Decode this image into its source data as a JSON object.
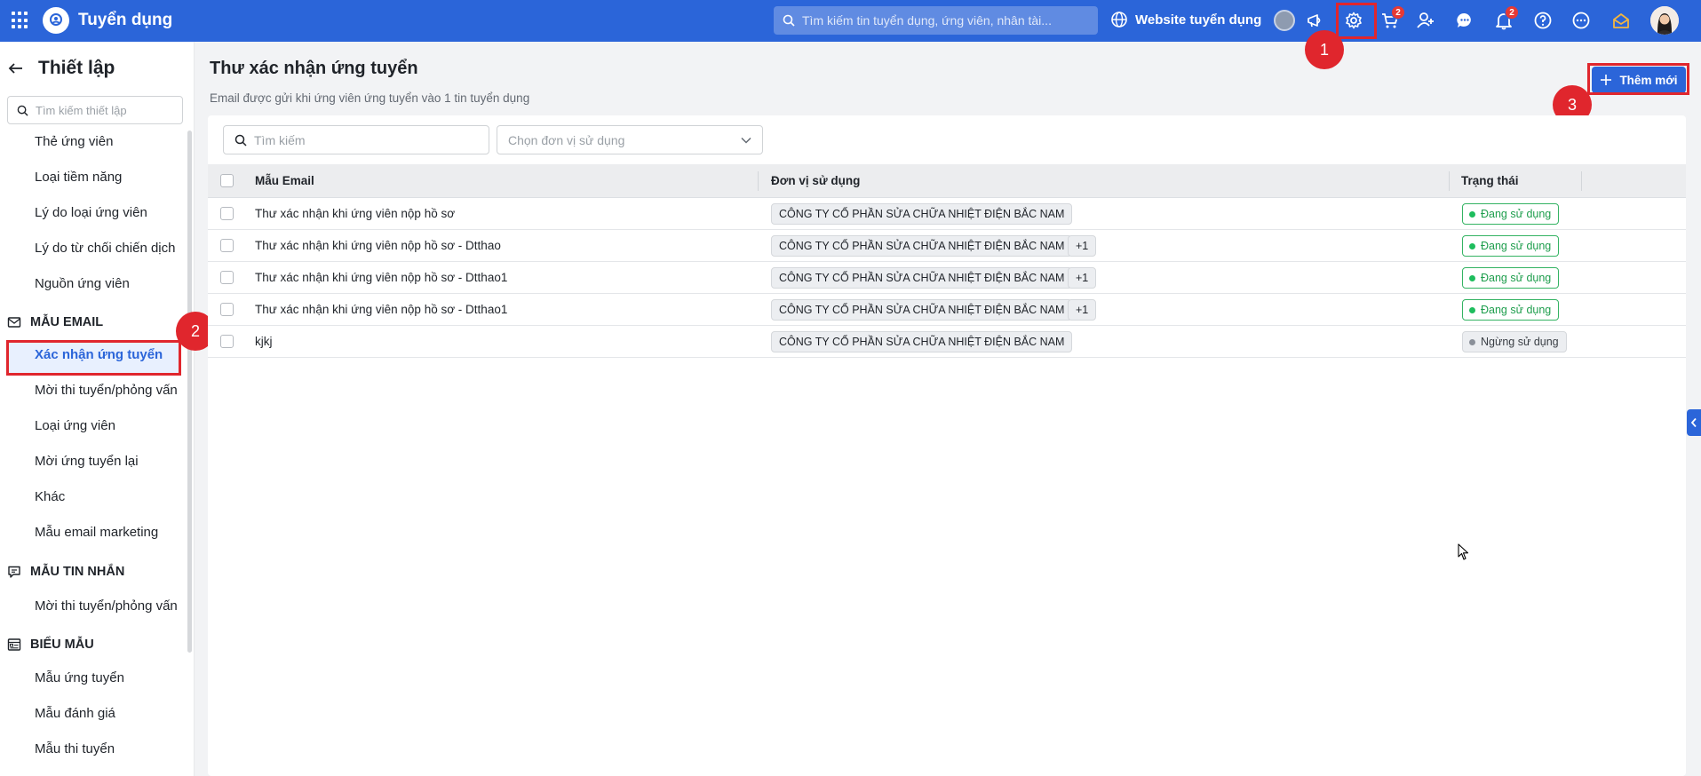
{
  "app": {
    "name": "Tuyển dụng"
  },
  "topbar": {
    "search_placeholder": "Tìm kiếm tin tuyển dụng, ứng viên, nhân tài...",
    "website_label": "Website tuyển dụng",
    "cart_badge": "2",
    "notification_badge": "2"
  },
  "annotations": {
    "step1": "1",
    "step2": "2",
    "step3": "3"
  },
  "sidebar": {
    "title": "Thiết lập",
    "search_placeholder": "Tìm kiếm thiết lập",
    "items_top": [
      "Thẻ ứng viên",
      "Loại tiềm năng",
      "Lý do loại ứng viên",
      "Lý do từ chối chiến dịch",
      "Nguồn ứng viên"
    ],
    "email_section": "MẪU EMAIL",
    "email_items": [
      "Xác nhận ứng tuyển",
      "Mời thi tuyển/phỏng vấn",
      "Loại ứng viên",
      "Mời ứng tuyển lại",
      "Khác",
      "Mẫu email marketing"
    ],
    "sms_section": "MẪU TIN NHẮN",
    "sms_items": [
      "Mời thi tuyển/phỏng vấn"
    ],
    "form_section": "BIỂU MẪU",
    "form_items": [
      "Mẫu ứng tuyển",
      "Mẫu đánh giá",
      "Mẫu thi tuyển"
    ]
  },
  "main": {
    "title": "Thư xác nhận ứng tuyển",
    "subtitle": "Email được gửi khi ứng viên ứng tuyển vào 1 tin tuyển dụng",
    "add_button": "Thêm mới",
    "search_placeholder": "Tìm kiếm",
    "unit_select_placeholder": "Chọn đơn vị sử dụng",
    "columns": {
      "template": "Mẫu Email",
      "unit": "Đơn vị sử dụng",
      "status": "Trạng thái"
    },
    "rows": [
      {
        "name": "Thư xác nhận khi ứng viên nộp hồ sơ",
        "unit": "CÔNG TY CỔ PHẦN SỬA CHỮA NHIỆT ĐIỆN BẮC NAM",
        "extra": "",
        "status": "Đang sử dụng"
      },
      {
        "name": "Thư xác nhận khi ứng viên nộp hồ sơ - Dtthao",
        "unit": "CÔNG TY CỔ PHẦN SỬA CHỮA NHIỆT ĐIỆN BẮC NAM",
        "extra": "+1",
        "status": "Đang sử dụng"
      },
      {
        "name": "Thư xác nhận khi ứng viên nộp hồ sơ - Dtthao1",
        "unit": "CÔNG TY CỔ PHẦN SỬA CHỮA NHIỆT ĐIỆN BẮC NAM",
        "extra": "+1",
        "status": "Đang sử dụng"
      },
      {
        "name": "Thư xác nhận khi ứng viên nộp hồ sơ - Dtthao1",
        "unit": "CÔNG TY CỔ PHẦN SỬA CHỮA NHIỆT ĐIỆN BẮC NAM",
        "extra": "+1",
        "status": "Đang sử dụng"
      },
      {
        "name": "kjkj",
        "unit": "CÔNG TY CỔ PHẦN SỬA CHỮA NHIỆT ĐIỆN BẮC NAM",
        "extra": "",
        "status": "Ngừng sử dụng"
      }
    ]
  },
  "colors": {
    "primary": "#2b65d9",
    "annotation": "#e0262d",
    "active_status": "#1e9e4d"
  }
}
